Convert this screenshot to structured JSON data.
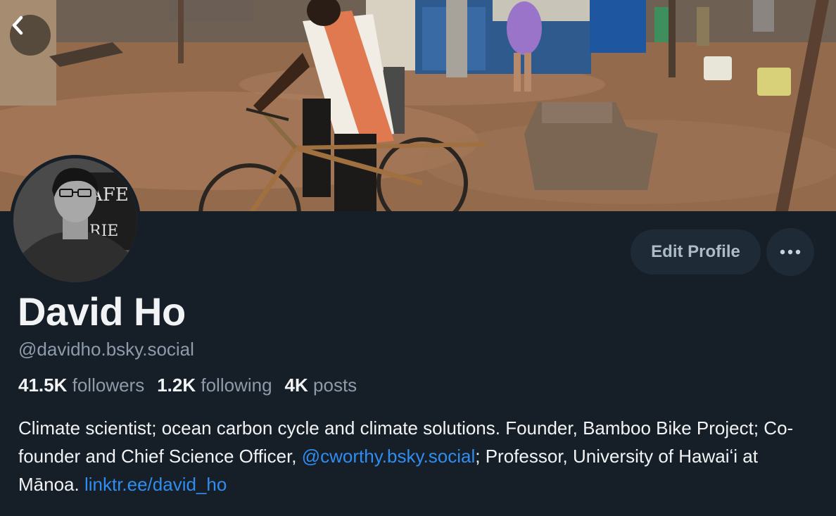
{
  "header": {
    "back_icon": "chevron-left-icon"
  },
  "actions": {
    "edit_label": "Edit Profile",
    "more_icon": "ellipsis-icon"
  },
  "profile": {
    "name": "David Ho",
    "handle": "@davidho.bsky.social",
    "stats": [
      {
        "value": "41.5K",
        "label": "followers"
      },
      {
        "value": "1.2K",
        "label": "following"
      },
      {
        "value": "4K",
        "label": "posts"
      }
    ],
    "bio": {
      "part1": "Climate scientist; ocean carbon cycle and climate solutions. Founder, Bamboo Bike Project; Co-founder and Chief Science Officer, ",
      "mention": "@cworthy.bsky.social",
      "part2": "; Professor, University of Hawaiʻi at Mānoa. ",
      "link": "linktr.ee/david_ho"
    }
  },
  "colors": {
    "background": "#161e27",
    "button_bg": "#1e2a36",
    "secondary_text": "#8d9bab",
    "link": "#2f8df0"
  }
}
